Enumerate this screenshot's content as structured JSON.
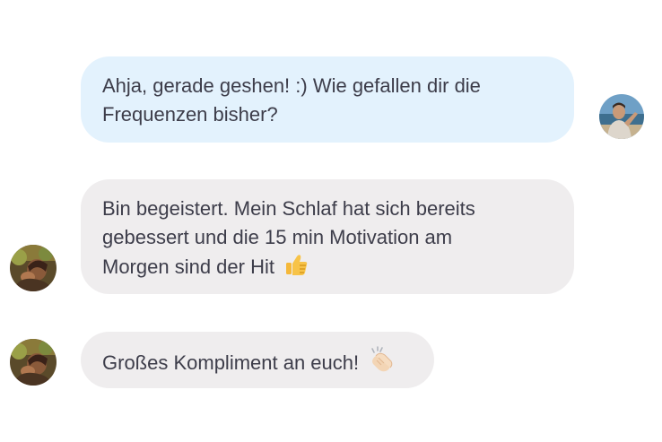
{
  "chat": {
    "messages": [
      {
        "sender": "me",
        "lines": [
          "Ahja, gerade geshen! :) Wie gefallen dir die",
          "Frequenzen bisher?"
        ]
      },
      {
        "sender": "other",
        "lines": [
          "Bin begeistert. Mein Schlaf hat sich bereits",
          "gebessert und die 15 min Motivation am",
          "Morgen sind der Hit"
        ],
        "emoji": "thumbs-up"
      },
      {
        "sender": "other",
        "lines": [
          "Großes Kompliment an euch!"
        ],
        "emoji": "clapping-hands"
      }
    ]
  },
  "colors": {
    "outgoing_bubble": "#e3f2fd",
    "incoming_bubble": "#efedee",
    "text": "#3d3d4a"
  }
}
